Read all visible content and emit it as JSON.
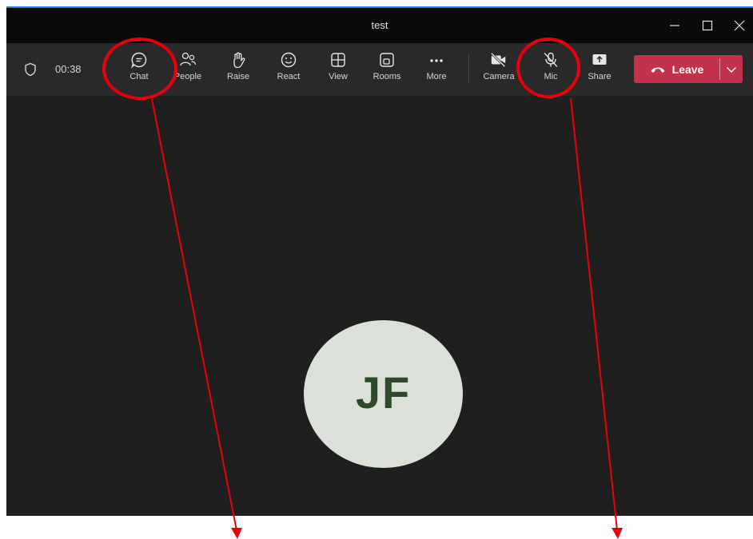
{
  "window": {
    "title": "test"
  },
  "toolbar": {
    "timer": "00:38",
    "buttons": [
      {
        "id": "chat",
        "label": "Chat",
        "icon": "chat-icon"
      },
      {
        "id": "people",
        "label": "People",
        "icon": "people-icon"
      },
      {
        "id": "raise",
        "label": "Raise",
        "icon": "hand-icon"
      },
      {
        "id": "react",
        "label": "React",
        "icon": "smiley-icon"
      },
      {
        "id": "view",
        "label": "View",
        "icon": "grid-icon"
      },
      {
        "id": "rooms",
        "label": "Rooms",
        "icon": "rooms-icon"
      },
      {
        "id": "more",
        "label": "More",
        "icon": "ellipsis-icon"
      },
      {
        "id": "camera",
        "label": "Camera",
        "icon": "camera-off-icon"
      },
      {
        "id": "mic",
        "label": "Mic",
        "icon": "mic-off-icon"
      },
      {
        "id": "share",
        "label": "Share",
        "icon": "share-icon"
      }
    ],
    "leave_label": "Leave"
  },
  "participant": {
    "initials": "JF"
  },
  "colors": {
    "leave": "#c4314b",
    "annotation": "#e8000b",
    "avatar_bg": "#dbe0d8",
    "avatar_text": "#2e4a2a"
  }
}
